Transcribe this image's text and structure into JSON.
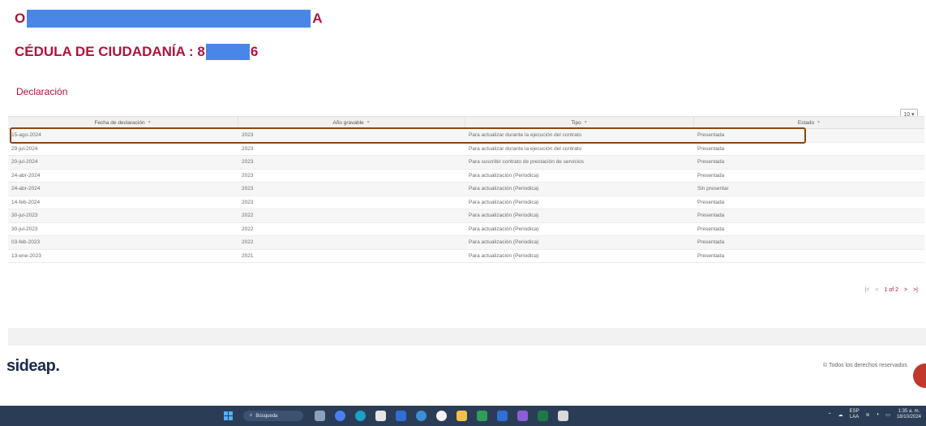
{
  "header": {
    "name_first": "O",
    "name_last": "A",
    "cedula_label": "CÉDULA DE CIUDADANÍA : 8",
    "cedula_end": "6"
  },
  "section": {
    "title": "Declaración"
  },
  "page_size": {
    "value": "10"
  },
  "table": {
    "columns": [
      "Fecha de declaración",
      "Año gravable",
      "Tipo",
      "Estado"
    ],
    "rows": [
      [
        "15-ago-2024",
        "2023",
        "Para actualizar durante la ejecución del contrato",
        "Presentada"
      ],
      [
        "29-jul-2024",
        "2023",
        "Para actualizar durante la ejecución del contrato",
        "Presentada"
      ],
      [
        "20-jul-2024",
        "2023",
        "Para suscribir contrato de prestación de servicios",
        "Presentada"
      ],
      [
        "24-abr-2024",
        "2023",
        "Para actualización (Periodica)",
        "Presentada"
      ],
      [
        "24-abr-2024",
        "2023",
        "Para actualización (Periodica)",
        "Sin presentar"
      ],
      [
        "14-feb-2024",
        "2023",
        "Para actualización (Periodica)",
        "Presentada"
      ],
      [
        "30-jul-2023",
        "2022",
        "Para actualización (Periodica)",
        "Presentada"
      ],
      [
        "30-jul-2023",
        "2022",
        "Para actualización (Periodica)",
        "Presentada"
      ],
      [
        "03-feb-2023",
        "2022",
        "Para actualización (Periodica)",
        "Presentada"
      ],
      [
        "13-ene-2023",
        "2021",
        "Para actualización (Periodica)",
        "Presentada"
      ]
    ]
  },
  "pager": {
    "first": "|<",
    "prev": "<",
    "info": "1 of 2",
    "next": ">",
    "last": ">|"
  },
  "footer": {
    "logo": "sideap.",
    "rights": "© Todos los derechos reservados"
  },
  "taskbar": {
    "search_placeholder": "Búsqueda",
    "lang_top": "ESP",
    "lang_bottom": "LAA",
    "time": "1:35 a. m.",
    "date": "18/10/2024"
  },
  "colors": {
    "accent": "#b0143c",
    "highlight": "#8b4513",
    "redaction": "#4a86e8"
  }
}
